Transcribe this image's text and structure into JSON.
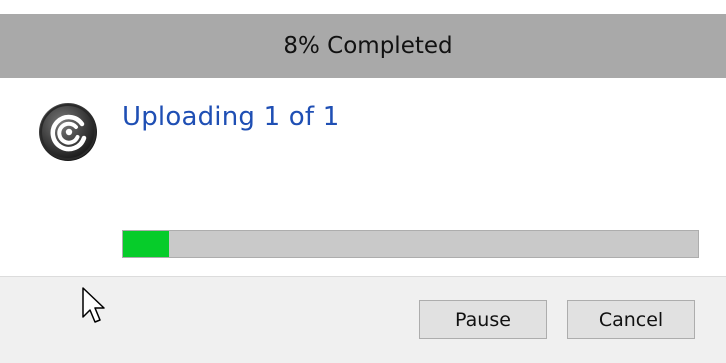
{
  "window": {
    "title": "8% Completed"
  },
  "main": {
    "icon": "app-spiral-icon",
    "heading": "Uploading 1 of 1"
  },
  "progress": {
    "value": 0.08,
    "fill_color": "#06cc2a",
    "track_color": "#c9c9c9"
  },
  "buttons": {
    "pause_label": "Pause",
    "cancel_label": "Cancel"
  },
  "colors": {
    "titlebar": "#a9a9a9",
    "heading": "#1f4fb4",
    "footer": "#f0f0f0"
  },
  "cursor": {
    "icon": "mouse-pointer-icon"
  }
}
